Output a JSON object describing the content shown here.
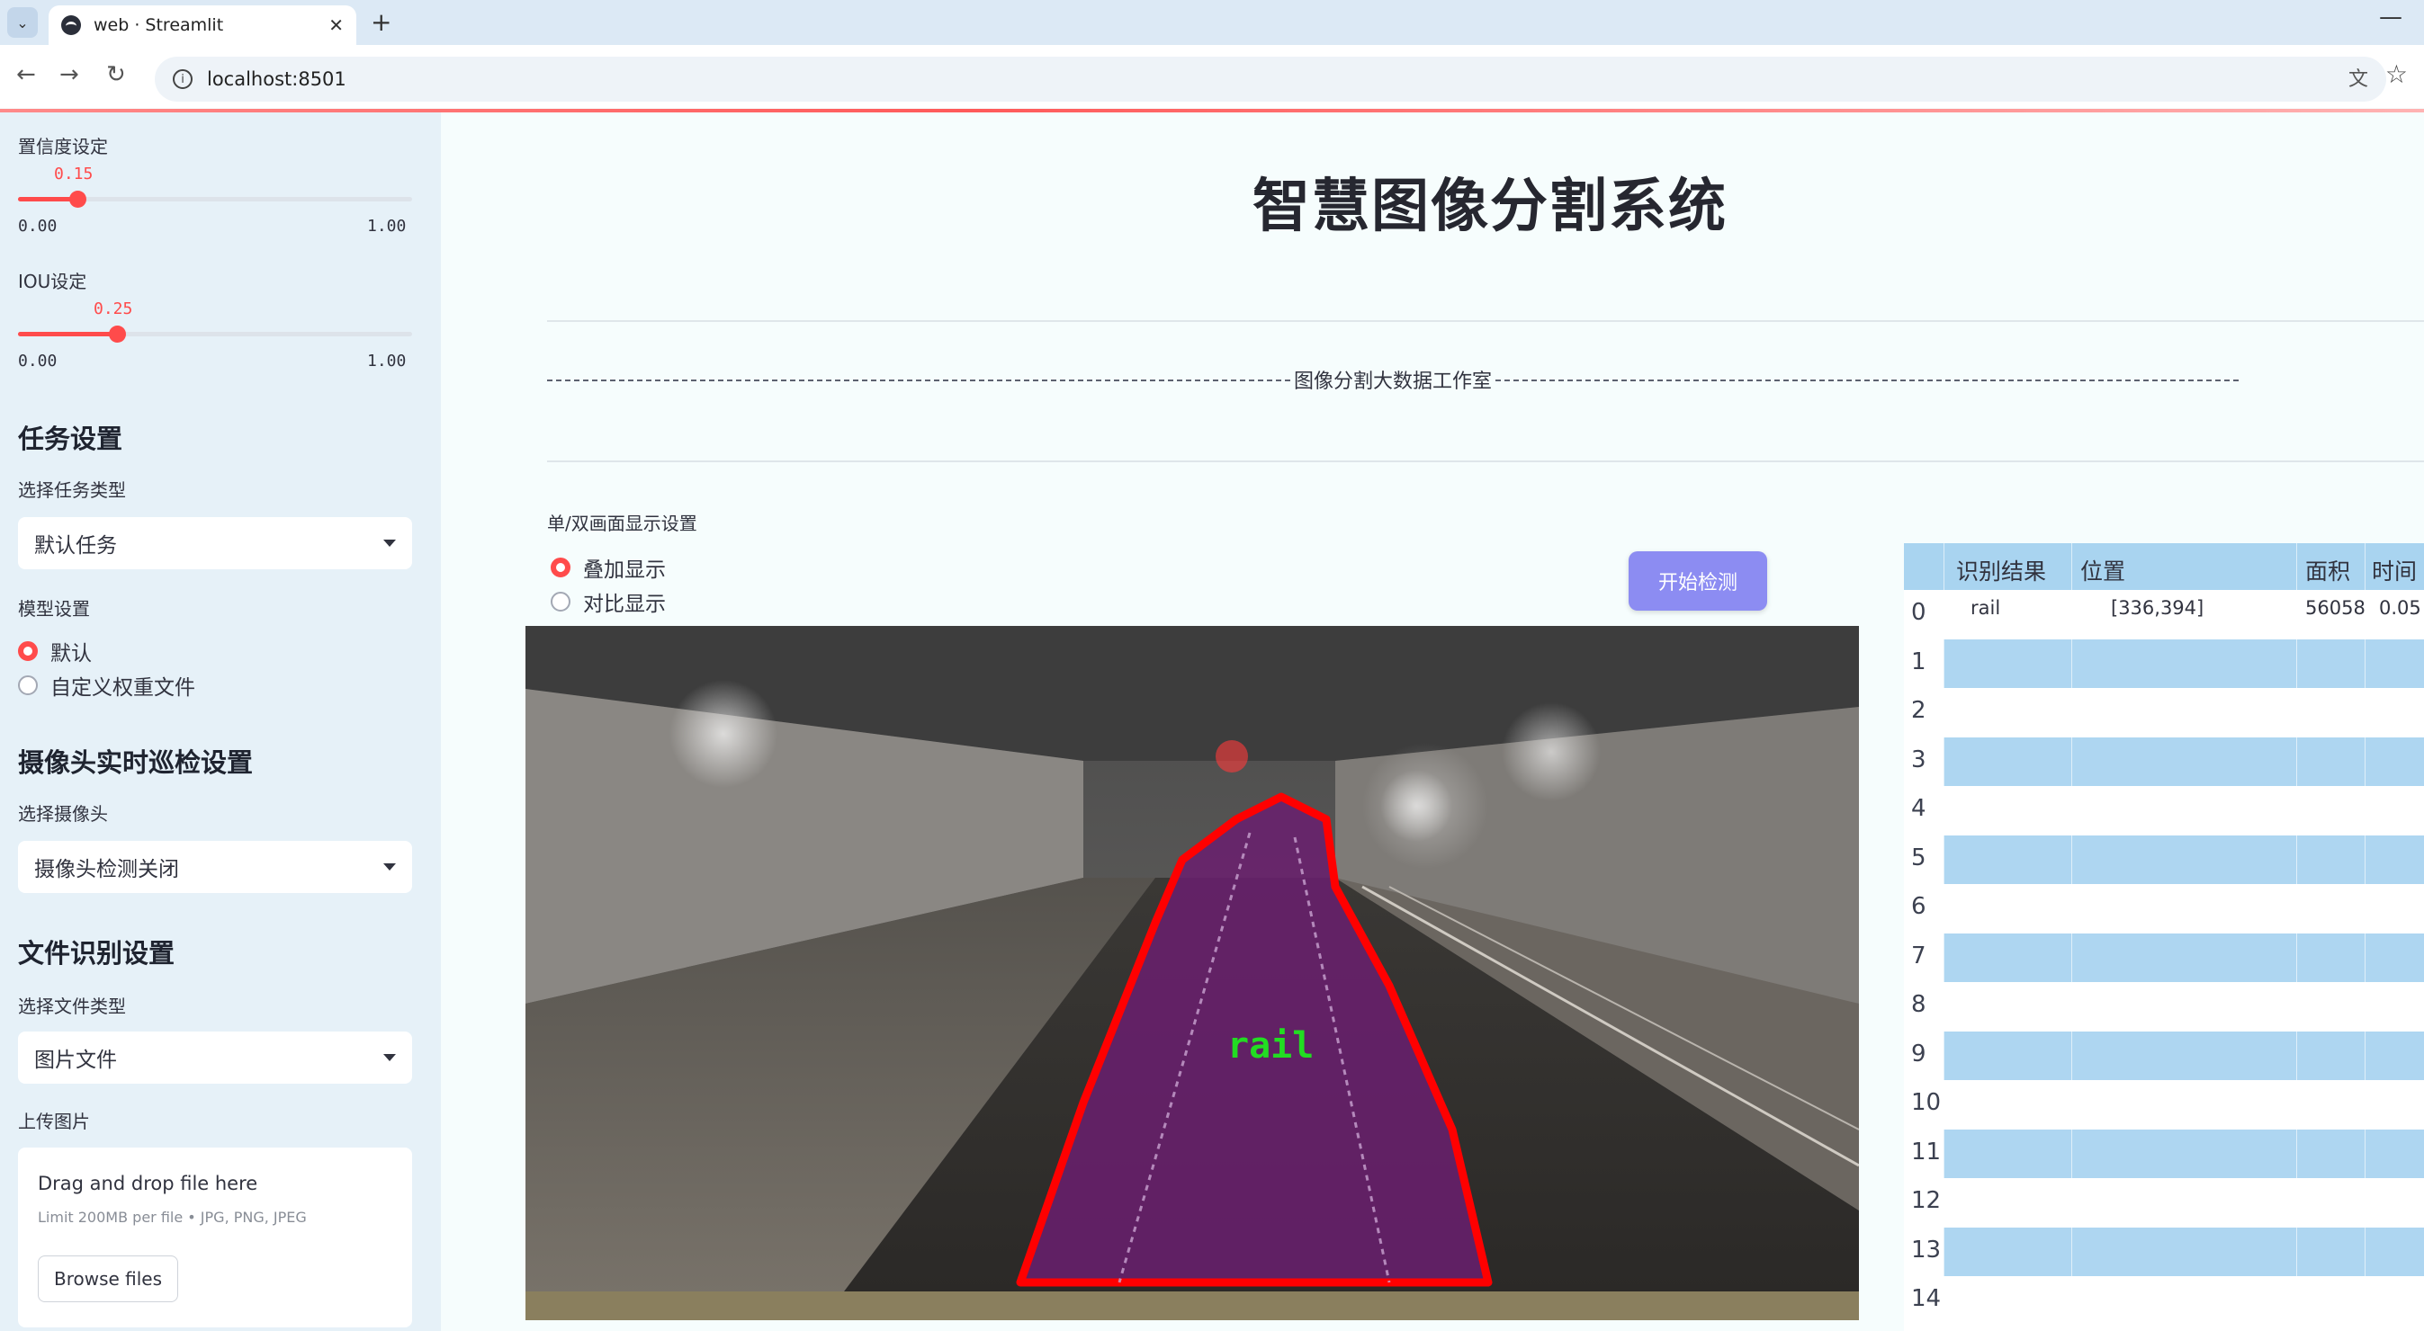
{
  "browser": {
    "tab_title": "web · Streamlit",
    "url": "localhost:8501"
  },
  "sidebar": {
    "confidence": {
      "label": "置信度设定",
      "value": "0.15",
      "value_num": 0.15,
      "min": "0.00",
      "max": "1.00"
    },
    "iou": {
      "label": "IOU设定",
      "value": "0.25",
      "value_num": 0.25,
      "min": "0.00",
      "max": "1.00"
    },
    "task_heading": "任务设置",
    "task_type_label": "选择任务类型",
    "task_type_value": "默认任务",
    "model_label": "模型设置",
    "model_options": [
      "默认",
      "自定义权重文件"
    ],
    "camera_heading": "摄像头实时巡检设置",
    "camera_label": "选择摄像头",
    "camera_value": "摄像头检测关闭",
    "file_heading": "文件识别设置",
    "file_type_label": "选择文件类型",
    "file_type_value": "图片文件",
    "upload_label": "上传图片",
    "upload_drop": "Drag and drop file here",
    "upload_limit": "Limit 200MB per file • JPG, PNG, JPEG",
    "upload_button": "Browse files"
  },
  "main": {
    "title": "智慧图像分割系统",
    "subtitle": "图像分割大数据工作室",
    "display_label": "单/双画面显示设置",
    "display_options": [
      "叠加显示",
      "对比显示"
    ],
    "start_button": "开始检测",
    "detection_label": "rail"
  },
  "table": {
    "headers": [
      "识别结果",
      "位置",
      "面积",
      "时间"
    ],
    "rows": [
      {
        "index": "0",
        "result": "rail",
        "position": "[336,394]",
        "area": "56058",
        "time": "0.05"
      },
      {
        "index": "1"
      },
      {
        "index": "2"
      },
      {
        "index": "3"
      },
      {
        "index": "4"
      },
      {
        "index": "5"
      },
      {
        "index": "6"
      },
      {
        "index": "7"
      },
      {
        "index": "8"
      },
      {
        "index": "9"
      },
      {
        "index": "10"
      },
      {
        "index": "11"
      },
      {
        "index": "12"
      },
      {
        "index": "13"
      },
      {
        "index": "14"
      }
    ]
  },
  "colors": {
    "accent": "#ff4b4b",
    "button": "#8c8cf2",
    "sidebar_bg": "#e6f1f8",
    "table_header": "#a9d4f0",
    "mask_fill": "#6a1f6e",
    "mask_outline": "#ff0000",
    "label_green": "#22dd22"
  }
}
